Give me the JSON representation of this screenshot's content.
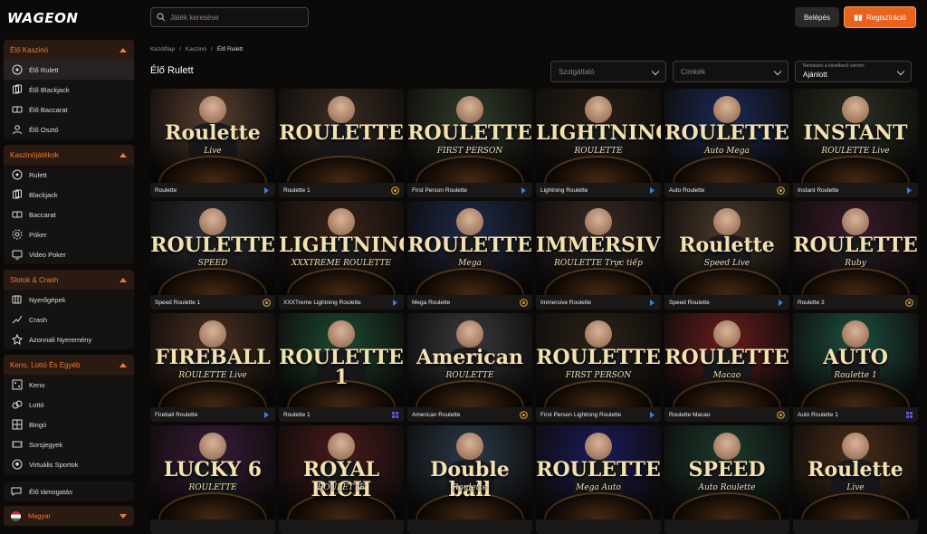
{
  "brand": {
    "logo": "WAGEON"
  },
  "search": {
    "placeholder": "Játék keresése"
  },
  "auth": {
    "login": "Belépés",
    "register": "Regisztráció"
  },
  "sidebar": {
    "sections": [
      {
        "title": "Élő Kaszinó",
        "items": [
          "Élő Rulett",
          "Élő Blackjack",
          "Élő Baccarat",
          "Élő Osztó"
        ],
        "icons": [
          "roulette-icon",
          "cards-icon",
          "baccarat-icon",
          "dealer-icon"
        ]
      },
      {
        "title": "Kaszinójátékok",
        "items": [
          "Rulett",
          "Blackjack",
          "Baccarat",
          "Póker",
          "Video Poker"
        ],
        "icons": [
          "roulette-icon",
          "cards-icon",
          "baccarat-icon",
          "poker-icon",
          "video-poker-icon"
        ]
      },
      {
        "title": "Slotok & Crash",
        "items": [
          "Nyerőgépek",
          "Crash",
          "Azonnali Nyeremény"
        ],
        "icons": [
          "slot-icon",
          "crash-icon",
          "instant-win-icon"
        ]
      },
      {
        "title": "Keno, Lottó És Egyéb",
        "items": [
          "Keno",
          "Lottó",
          "Bingó",
          "Sorsjegyek",
          "Virtuális Sportok"
        ],
        "icons": [
          "keno-icon",
          "lotto-icon",
          "bingo-icon",
          "ticket-icon",
          "virtual-sports-icon"
        ]
      }
    ],
    "support": "Élő támogatás",
    "language": "Magyar"
  },
  "breadcrumb": [
    "Kezdőlap",
    "Kaszinó",
    "Élő Rulett"
  ],
  "page_title": "Élő Rulett",
  "filters": {
    "provider": {
      "placeholder": "Szolgáltató"
    },
    "tags": {
      "placeholder": "Címkék"
    },
    "sort": {
      "label": "Rendezés a következő szerint:",
      "value": "Ajánlott"
    }
  },
  "games": [
    {
      "name": "Roulette",
      "art": "Roulette",
      "sub": "Live",
      "bg": "#5a4030",
      "provider": "evolution"
    },
    {
      "name": "Roulette 1",
      "art": "ROULETTE",
      "sub": "",
      "bg": "#3a2c22",
      "provider": "pragmatic"
    },
    {
      "name": "First Person Roulette",
      "art": "ROULETTE",
      "sub": "FIRST PERSON",
      "bg": "#2f3c2a",
      "provider": "evolution"
    },
    {
      "name": "Lightning Roulette",
      "art": "LIGHTNING",
      "sub": "ROULETTE",
      "bg": "#2a2016",
      "provider": "evolution"
    },
    {
      "name": "Auto Roulette",
      "art": "ROULETTE",
      "sub": "Auto Mega",
      "bg": "#1a2a55",
      "provider": "pragmatic"
    },
    {
      "name": "Instant Roulette",
      "art": "INSTANT",
      "sub": "ROULETTE Live",
      "bg": "#2a3022",
      "provider": "evolution"
    },
    {
      "name": "Speed Roulette 1",
      "art": "ROULETTE",
      "sub": "SPEED",
      "bg": "#2c3036",
      "provider": "pragmatic"
    },
    {
      "name": "XXXTreme Lightning Roulette",
      "art": "LIGHTNING",
      "sub": "XXXTREME ROULETTE",
      "bg": "#3a2418",
      "provider": "evolution"
    },
    {
      "name": "Mega Roulette",
      "art": "ROULETTE",
      "sub": "Mega",
      "bg": "#1e2a4a",
      "provider": "pragmatic"
    },
    {
      "name": "Immersive Roulette",
      "art": "IMMERSIVE",
      "sub": "ROULETTE Trực tiếp",
      "bg": "#3a2a24",
      "provider": "evolution"
    },
    {
      "name": "Speed Roulette",
      "art": "Roulette",
      "sub": "Speed Live",
      "bg": "#4a3a2a",
      "provider": "evolution"
    },
    {
      "name": "Roulette 3",
      "art": "ROULETTE",
      "sub": "Ruby",
      "bg": "#3a1a2a",
      "provider": "pragmatic"
    },
    {
      "name": "Fireball Roulette",
      "art": "FIREBALL",
      "sub": "ROULETTE Live",
      "bg": "#4a3020",
      "provider": "evolution"
    },
    {
      "name": "Roulette 1",
      "art": "ROULETTE 1",
      "sub": "",
      "bg": "#1c4a30",
      "provider": "other"
    },
    {
      "name": "American Roulette",
      "art": "American",
      "sub": "ROULETTE",
      "bg": "#3a3a3e",
      "provider": "pragmatic"
    },
    {
      "name": "First Person Lightning Roulette",
      "art": "ROULETTE",
      "sub": "FIRST PERSON",
      "bg": "#2a2218",
      "provider": "evolution"
    },
    {
      "name": "Roulette Macao",
      "art": "ROULETTE",
      "sub": "Macao",
      "bg": "#6a1c1c",
      "provider": "pragmatic"
    },
    {
      "name": "Auto Roulette 1",
      "art": "AUTO",
      "sub": "Roulette 1",
      "bg": "#1c5040",
      "provider": "other"
    },
    {
      "name": "",
      "art": "LUCKY 6",
      "sub": "ROULETTE",
      "bg": "#3a1a3a",
      "provider": ""
    },
    {
      "name": "",
      "art": "ROYAL RICH",
      "sub": "ROULETTE",
      "bg": "#4a1a1a",
      "provider": ""
    },
    {
      "name": "",
      "art": "Double ball",
      "sub": "Roulette",
      "bg": "#2a3a4a",
      "provider": ""
    },
    {
      "name": "",
      "art": "ROULETTE",
      "sub": "Mega Auto",
      "bg": "#1a1a5a",
      "provider": ""
    },
    {
      "name": "",
      "art": "SPEED",
      "sub": "Auto Roulette",
      "bg": "#1c3a2c",
      "provider": ""
    },
    {
      "name": "",
      "art": "Roulette",
      "sub": "Live",
      "bg": "#4a2e18",
      "provider": ""
    }
  ],
  "colors": {
    "accent": "#f07a2d",
    "register_bg": "#e8621c",
    "evolution": "#3d7bea",
    "pragmatic": "#c89a3a",
    "other": "#5a5ae0"
  }
}
